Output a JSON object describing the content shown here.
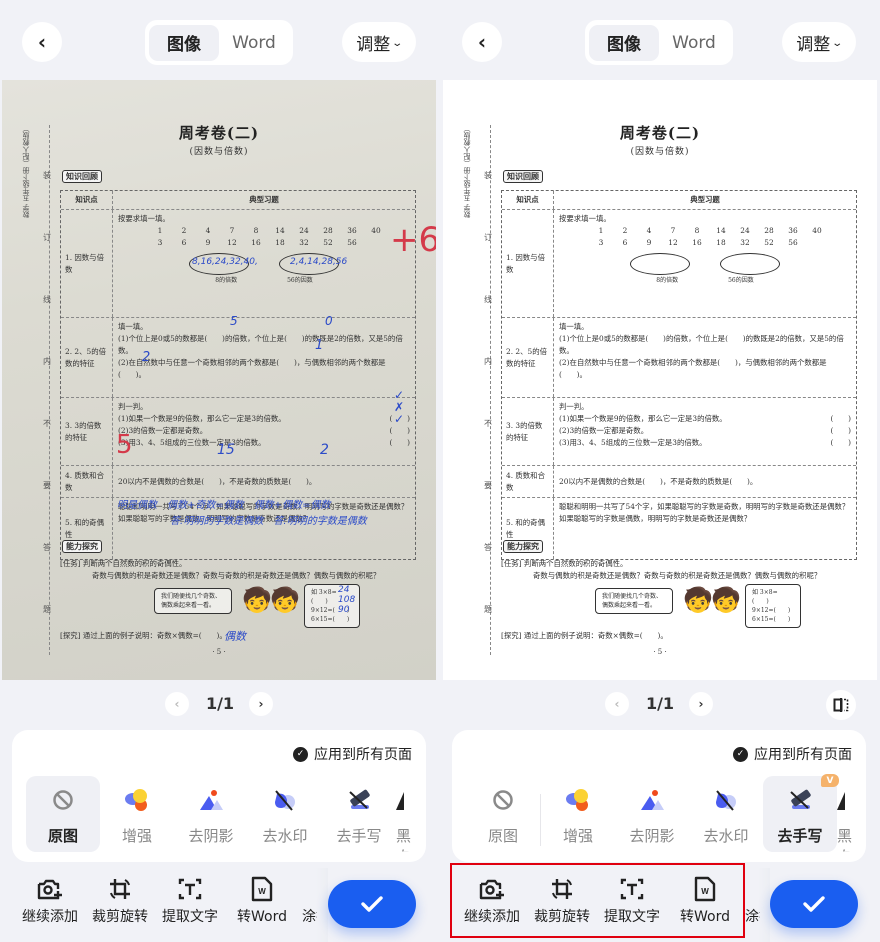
{
  "header": {
    "back_icon": "chevron-left-icon",
    "tabs": [
      {
        "label": "图像",
        "selected": true
      },
      {
        "label": "Word",
        "selected": false
      }
    ],
    "adjust_label": "调整",
    "adjust_icon": "chevron-down-icon"
  },
  "document": {
    "margin_text": "数学 五年级下册（配人教版）",
    "margin_fields": [
      "学号",
      "姓名",
      "班级",
      "学校"
    ],
    "binding_marks": [
      "装",
      "订",
      "线",
      "内",
      "不",
      "要",
      "答",
      "题"
    ],
    "title": "周考卷(二)",
    "subtitle": "(因数与倍数)",
    "section1_heading": "知识回顾",
    "table_headers": [
      "知识点",
      "典型习题"
    ],
    "rows": [
      {
        "topic": "1. 因数与倍数",
        "lines": [
          "按要求填一填。"
        ],
        "numbers_row1": [
          "1",
          "2",
          "4",
          "7",
          "8",
          "14",
          "24",
          "28",
          "36",
          "40"
        ],
        "numbers_row2": [
          "3",
          "6",
          "9",
          "12",
          "16",
          "18",
          "32",
          "52",
          "56"
        ],
        "oval_labels": [
          "8的倍数",
          "56的因数"
        ]
      },
      {
        "topic": "2. 2、5的倍数的特征",
        "lines": [
          "填一填。",
          "(1)个位上是0或5的数都是(　　)的倍数，个位上是(　　)的数既是2的倍数，又是5的倍数。",
          "(2)在自然数中与任意一个奇数相邻的两个数都是(　　)，与偶数相邻的两个数都是(　　)。"
        ]
      },
      {
        "topic": "3. 3的倍数的特征",
        "lines": [
          "判一判。",
          "(1)如果一个数是9的倍数，那么它一定是3的倍数。",
          "(2)3的倍数一定都是奇数。",
          "(3)用3、4、5组成的三位数一定是3的倍数。"
        ],
        "judge_paren": "(　　)"
      },
      {
        "topic": "4. 质数和合数",
        "lines": [
          "20以内不是偶数的合数是(　　)，不是奇数的质数是(　　)。"
        ]
      },
      {
        "topic": "5. 和的奇偶性",
        "lines": [
          "聪聪和明明一共写了54个字，如果聪聪写的字数是奇数，明明写的字数是奇数还是偶数？如果聪聪写的字数是偶数，明明写的字数是奇数还是偶数？"
        ]
      }
    ],
    "section2_heading": "能力探究",
    "task_label": "[任务]",
    "task_line1": "判断两个自然数的积的奇偶性。",
    "task_line2": "奇数与偶数的积是奇数还是偶数？奇数与奇数的积是奇数还是偶数？偶数与偶数的积呢？",
    "bubble_text": "我们随便找几个奇数、偶数乘起来看一看。",
    "examples": [
      "如 3×8=(　　)",
      "9×12=(　　)",
      "6×15=(　　)"
    ],
    "explore_label": "[探究]",
    "explore_text": "通过上面的例子说明：奇数×偶数=(　　)。",
    "page_number": "· 5 ·",
    "handwriting": {
      "oval1": "8,16,24,32,40,",
      "oval2": "2,4,14,28,56",
      "q2_a": "5",
      "q2_b": "0",
      "q2_c": "1",
      "q2_d": "2",
      "q3": [
        "✓",
        "✗",
        "✓"
      ],
      "q4_a": "15",
      "q4_b": "2",
      "q5_line1": "明是偶数　偶数+奇数=偶数　偶数+偶数=偶数",
      "q5_line2": "答:明明的字数是偶数　答:明明的字数是偶数",
      "ex": [
        "24",
        "108",
        "90"
      ],
      "explore": "偶数",
      "score_mark": "+6",
      "q4_score": "5"
    }
  },
  "pager": {
    "current": "1/1",
    "prev_icon": "chevron-left-icon",
    "next_icon": "chevron-right-icon",
    "compare_icon": "compare-split-icon"
  },
  "filter_panel": {
    "apply_all_label": "应用到所有页面",
    "apply_all_checked": true,
    "filters": [
      {
        "label": "原图",
        "icon": "no-filter-icon"
      },
      {
        "label": "增强",
        "icon": "enhance-icon"
      },
      {
        "label": "去阴影",
        "icon": "remove-shadow-icon"
      },
      {
        "label": "去水印",
        "icon": "remove-watermark-icon"
      },
      {
        "label": "去手写",
        "icon": "remove-handwriting-icon",
        "badge": "V"
      },
      {
        "label": "黑白",
        "icon": "black-white-icon"
      }
    ],
    "left_selected": "原图",
    "right_selected": "去手写"
  },
  "toolbar": {
    "tools": [
      {
        "label": "继续添加",
        "icon": "add-photo-icon"
      },
      {
        "label": "裁剪旋转",
        "icon": "crop-rotate-icon"
      },
      {
        "label": "提取文字",
        "icon": "extract-text-icon"
      },
      {
        "label": "转Word",
        "icon": "word-file-icon"
      },
      {
        "label": "涂抹",
        "icon": "smear-icon"
      }
    ],
    "confirm_icon": "checkmark-icon"
  },
  "colors": {
    "accent": "#1a5ef0",
    "background": "#f1f2f7",
    "highlight_box": "#e0000f",
    "vip_badge": "#f5b26b",
    "ink_blue": "#2c4bc8",
    "ink_red": "#d43a4a"
  }
}
